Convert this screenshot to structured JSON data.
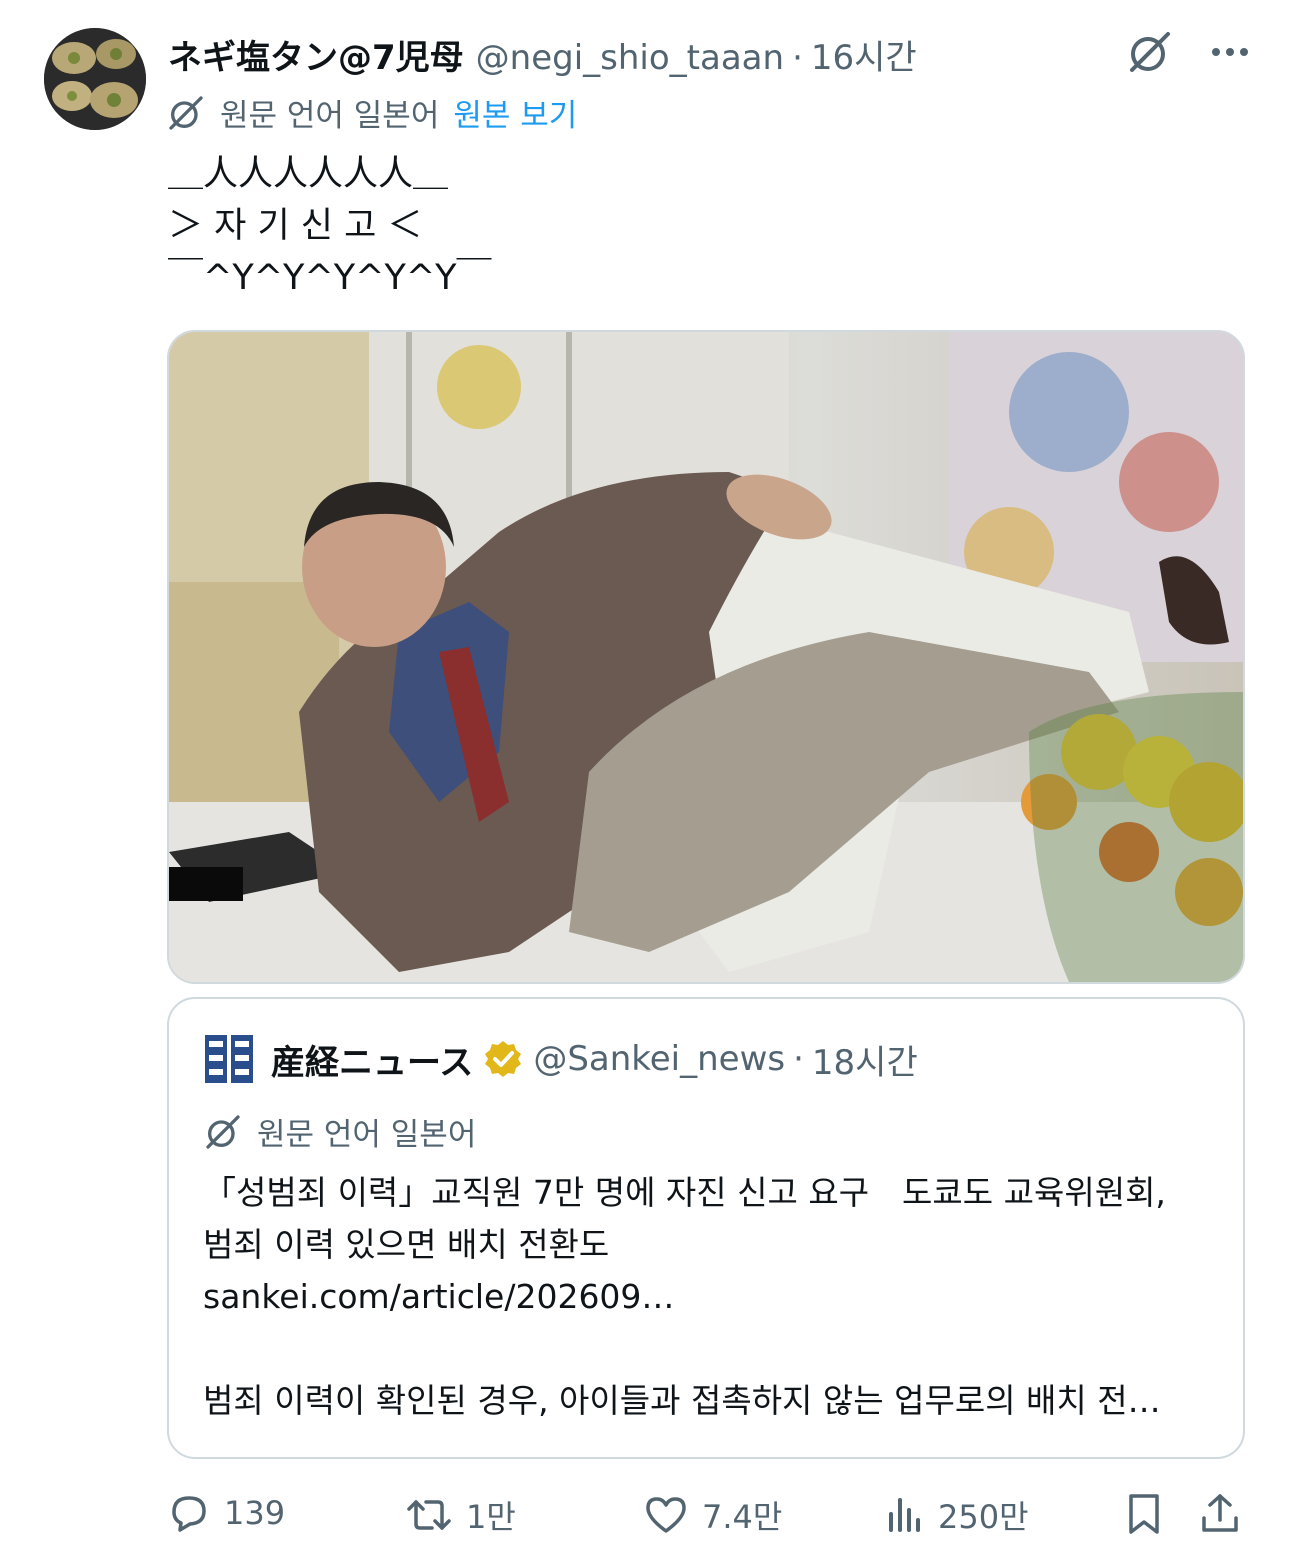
{
  "tweet": {
    "display_name": "ネギ塩タン@7児母",
    "handle": "@negi_shio_taaan",
    "separator": "·",
    "time": "16시간",
    "translation": {
      "label": "원문 언어 일본어",
      "link": "원본 보기"
    },
    "text": "＿人人人人人人＿\n＞ 자 기 신 고 ＜\n￣^Y^Y^Y^Y^Y￣",
    "avatar_icon": "food-photo-avatar",
    "media_icon": "photo-man-falling-on-stage",
    "grok_icon": "grok-icon",
    "more_icon": "more-icon"
  },
  "quote": {
    "logo_icon": "sankei-logo",
    "display_name": "産経ニュース",
    "verified_icon": "verified-gold-badge-icon",
    "handle": "@Sankei_news",
    "separator": "·",
    "time": "18시간",
    "translation_label": "원문 언어 일본어",
    "lines": [
      "「성범죄 이력」교직원 7만 명에 자진 신고 요구　도쿄도 교육위원회,",
      "범죄 이력 있으면 배치 전환도",
      "sankei.com/article/202609…",
      "",
      "범죄 이력이 확인된 경우, 아이들과 접촉하지 않는 업무로의 배치 전…"
    ]
  },
  "actions": {
    "reply": "139",
    "retweet": "1만",
    "like": "7.4만",
    "views": "250만"
  },
  "colors": {
    "text": "#0f1419",
    "secondary": "#536471",
    "link": "#1d9bf0",
    "border": "#cfd9de",
    "verified": "#e2b719"
  }
}
